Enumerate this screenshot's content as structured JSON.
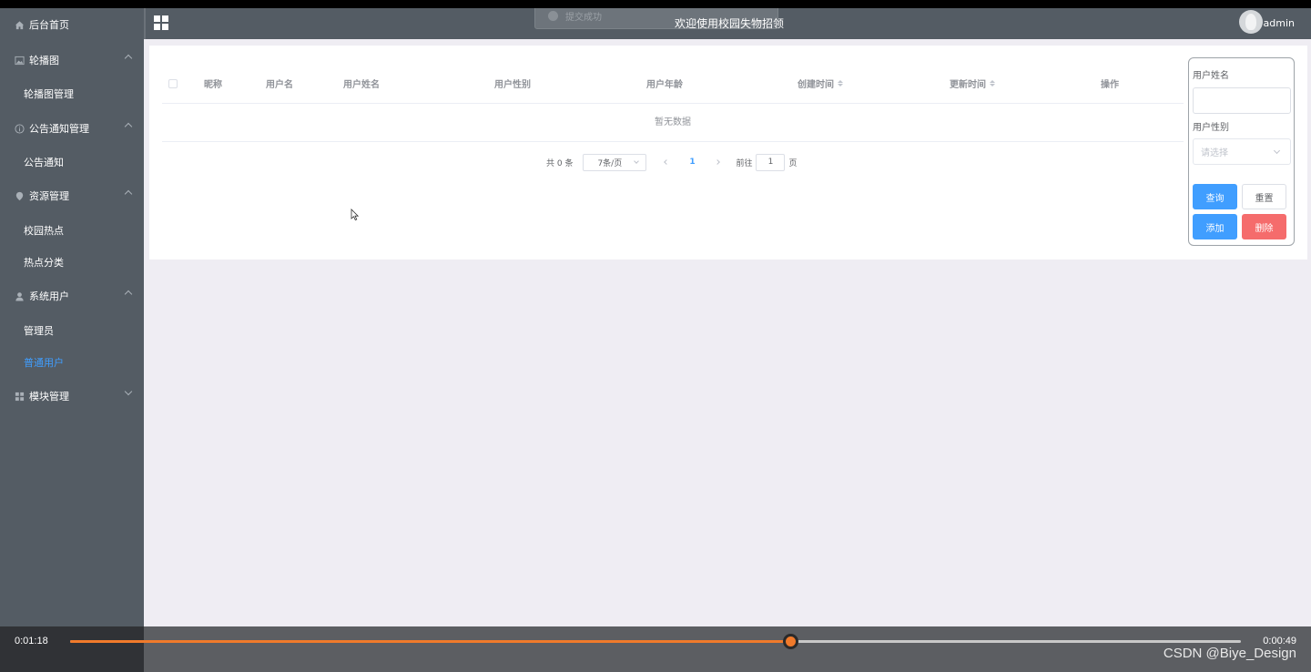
{
  "topbar": {
    "title": "欢迎使用校园失物招领",
    "toast": "提交成功",
    "username": "admin"
  },
  "sidebar": {
    "items": [
      {
        "label": "后台首页",
        "icon": "home-icon",
        "expandable": false
      },
      {
        "label": "轮播图",
        "icon": "picture-icon",
        "expandable": true,
        "expanded": true,
        "children": [
          {
            "label": "轮播图管理"
          }
        ]
      },
      {
        "label": "公告通知管理",
        "icon": "info-icon",
        "expandable": true,
        "expanded": true,
        "children": [
          {
            "label": "公告通知"
          }
        ]
      },
      {
        "label": "资源管理",
        "icon": "location-icon",
        "expandable": true,
        "expanded": true,
        "children": [
          {
            "label": "校园热点"
          },
          {
            "label": "热点分类"
          }
        ]
      },
      {
        "label": "系统用户",
        "icon": "user-icon",
        "expandable": true,
        "expanded": true,
        "children": [
          {
            "label": "管理员"
          },
          {
            "label": "普通用户",
            "active": true
          }
        ]
      },
      {
        "label": "模块管理",
        "icon": "grid-icon",
        "expandable": true,
        "expanded": false
      }
    ],
    "active_color": "#409eff"
  },
  "table": {
    "columns": [
      {
        "label": "昵称",
        "sortable": false
      },
      {
        "label": "用户名",
        "sortable": false
      },
      {
        "label": "用户姓名",
        "sortable": false
      },
      {
        "label": "用户性别",
        "sortable": false
      },
      {
        "label": "用户年龄",
        "sortable": false
      },
      {
        "label": "创建时间",
        "sortable": true
      },
      {
        "label": "更新时间",
        "sortable": true
      },
      {
        "label": "操作",
        "sortable": false
      }
    ],
    "empty_text": "暂无数据"
  },
  "pagination": {
    "total": "共 0 条",
    "page_size": "7条/页",
    "current_page": "1",
    "goto_prefix": "前往",
    "goto_value": "1",
    "goto_suffix": "页"
  },
  "search_panel": {
    "name_label": "用户姓名",
    "name_value": "",
    "gender_label": "用户性别",
    "gender_placeholder": "请选择",
    "query_button": "查询",
    "reset_button": "重置",
    "add_button": "添加",
    "delete_button": "删除"
  },
  "video": {
    "elapsed": "0:01:18",
    "remaining": "0:00:49",
    "progress": 0.615,
    "watermark": "CSDN @Biye_Design",
    "accent": "#f07a2b"
  }
}
